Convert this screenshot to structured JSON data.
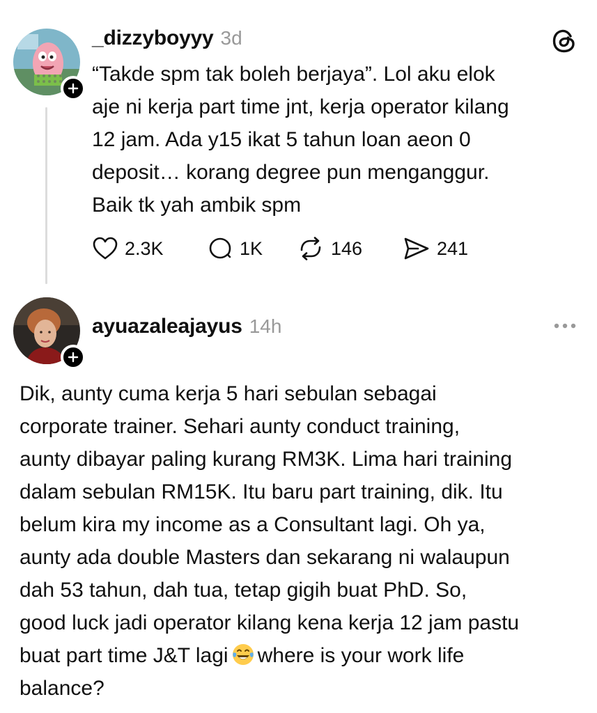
{
  "posts": [
    {
      "username": "_dizzyboyyy",
      "time": "3d",
      "text": "“Takde spm tak boleh berjaya”. Lol aku elok\naje ni kerja part time jnt, kerja operator kilang\n12 jam. Ada y15 ikat 5 tahun loan aeon 0\ndeposit… korang degree pun menganggur.\nBaik tk yah ambik spm",
      "stats": {
        "likes": "2.3K",
        "replies": "1K",
        "reposts": "146",
        "shares": "241"
      }
    },
    {
      "username": "ayuazaleajayus",
      "time": "14h",
      "text_before_emoji": "Dik, aunty cuma kerja 5 hari sebulan sebagai\ncorporate trainer. Sehari aunty conduct training,\naunty dibayar paling kurang RM3K. Lima hari training\ndalam sebulan RM15K. Itu baru part training, dik. Itu\nbelum kira my income as a Consultant lagi. Oh ya,\naunty ada double Masters dan sekarang ni walaupun\ndah 53 tahun, dah tua, tetap gigih buat PhD. So,\ngood luck jadi operator kilang kena kerja 12 jam pastu\nbuat part time J&T lagi",
      "text_after_emoji": "where is your work life\nbalance?"
    }
  ],
  "icons": {
    "brand": "threads-logo-icon",
    "like": "heart-icon",
    "reply": "comment-icon",
    "repost": "repost-icon",
    "share": "send-icon",
    "more": "more-options-icon",
    "emoji": "tears-of-joy-emoji"
  },
  "colors": {
    "text": "#101010",
    "muted": "#999999",
    "divider": "#dcdcdc",
    "badge": "#000000"
  }
}
